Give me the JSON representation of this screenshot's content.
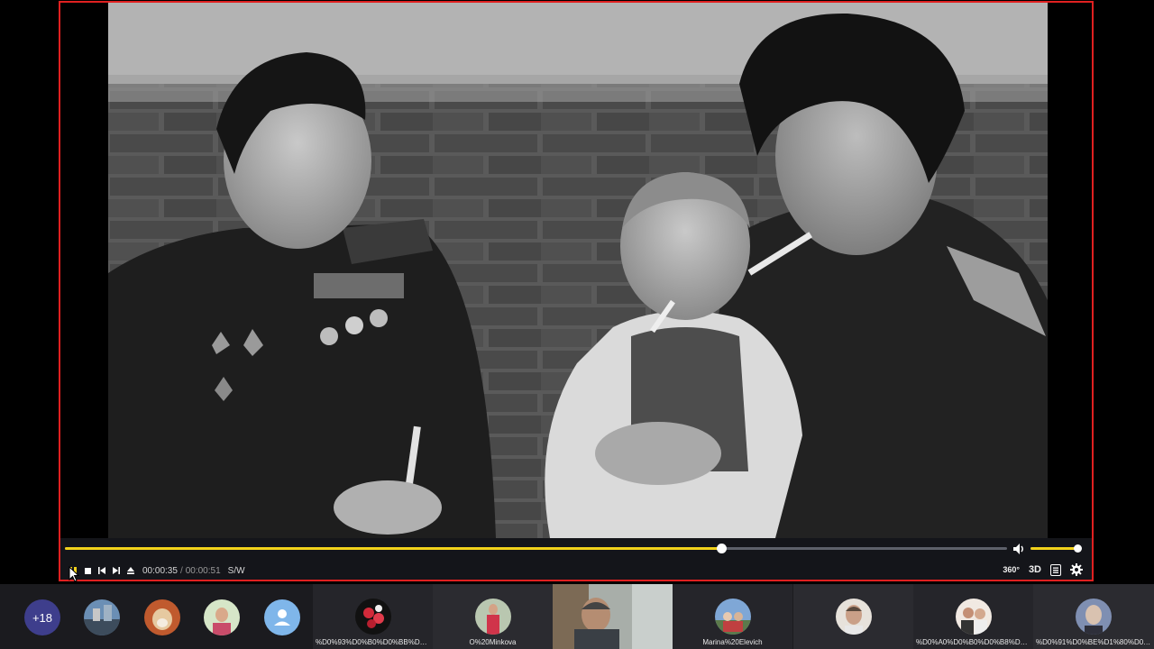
{
  "player": {
    "current_time": "00:00:35",
    "time_separator": "/",
    "duration": "00:00:51",
    "mode_label": "S/W",
    "progress": 0.697,
    "volume": 0.95,
    "btn_360": "360°",
    "btn_3d": "3D"
  },
  "colors": {
    "accent": "#f2d21b",
    "frame_border": "#e02020",
    "count_badge": "#3e3e8c"
  },
  "participants": {
    "more_count": "+18",
    "tiles": [
      {
        "name": "%D0%93%D0%B0%D0%BB%D0%B8..."
      },
      {
        "name": "O%20Minkova"
      },
      {
        "name": ""
      },
      {
        "name": "Marina%20Elevich"
      },
      {
        "name": ""
      },
      {
        "name": "%D0%A0%D0%B0%D0%B8%D1%81..."
      },
      {
        "name": "%D0%91%D0%BE%D1%80%D0%B8..."
      }
    ]
  }
}
